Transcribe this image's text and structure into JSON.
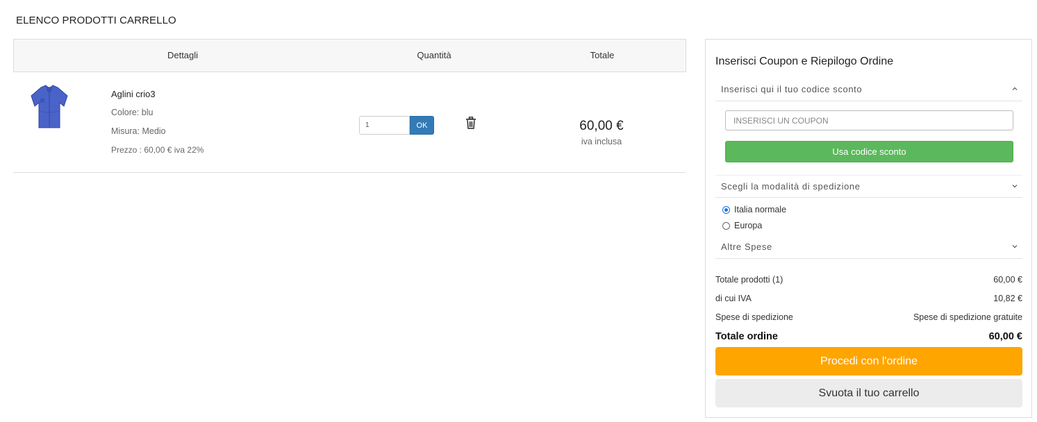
{
  "page": {
    "title": "ELENCO PRODOTTI CARRELLO"
  },
  "cart": {
    "headers": {
      "details": "Dettagli",
      "quantity": "Quantità",
      "total": "Totale"
    },
    "items": [
      {
        "name": "Aglini crio3",
        "color": "Colore: blu",
        "size": "Misura: Medio",
        "price": "Prezzo : 60,00 € iva 22%",
        "quantity": "1",
        "ok_label": "OK",
        "total": "60,00 €",
        "total_note": "iva inclusa",
        "image_icon": "shirt-icon",
        "image_color": "#4a63c8"
      }
    ]
  },
  "summary": {
    "title": "Inserisci Coupon e Riepilogo Ordine",
    "coupon_section": "Inserisci qui il tuo codice sconto",
    "coupon_placeholder": "INSERISCI UN COUPON",
    "coupon_button": "Usa codice sconto",
    "shipping_section": "Scegli la modalità di spedizione",
    "shipping_options": [
      {
        "label": "Italia normale",
        "selected": true
      },
      {
        "label": "Europa",
        "selected": false
      }
    ],
    "other_section": "Altre Spese",
    "totals": {
      "products_label": "Totale prodotti (1)",
      "products_value": "60,00 €",
      "vat_label": "di cui IVA",
      "vat_value": "10,82 €",
      "shipping_label": "Spese di spedizione",
      "shipping_value": "Spese di spedizione gratuite",
      "order_label": "Totale ordine",
      "order_value": "60,00 €"
    },
    "proceed_button": "Procedi con l'ordine",
    "empty_button": "Svuota il tuo carrello"
  },
  "colors": {
    "primary_blue": "#337ab7",
    "coupon_green": "#5cb85c",
    "proceed_orange": "#ffa500",
    "radio_blue": "#1a73e8"
  }
}
